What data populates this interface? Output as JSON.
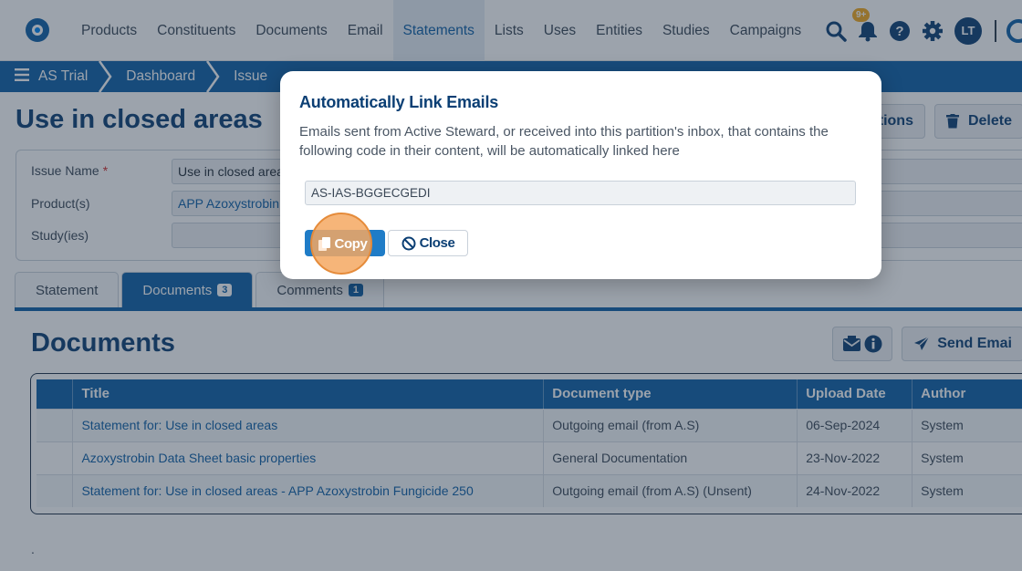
{
  "nav": {
    "items": [
      "Products",
      "Constituents",
      "Documents",
      "Email",
      "Statements",
      "Lists",
      "Uses",
      "Entities",
      "Studies",
      "Campaigns"
    ],
    "active_index": 4,
    "notification_badge": "9+",
    "avatar_initials": "LT",
    "icons": [
      "search-icon",
      "bell-icon",
      "help-icon",
      "gear-icon"
    ]
  },
  "breadcrumb": [
    "AS Trial",
    "Dashboard",
    "Issue"
  ],
  "page": {
    "title": "Use in closed areas",
    "actions": [
      "ations",
      "Delete"
    ]
  },
  "form": {
    "issue_name_label": "Issue Name",
    "issue_name_required": "*",
    "issue_name_value": "Use in closed area",
    "products_label": "Product(s)",
    "products_value": "APP Azoxystrobin",
    "studies_label": "Study(ies)",
    "studies_value": ""
  },
  "tabs": [
    {
      "label": "Statement",
      "count": ""
    },
    {
      "label": "Documents",
      "count": "3"
    },
    {
      "label": "Comments",
      "count": "1"
    }
  ],
  "documents": {
    "title": "Documents",
    "send_email_label": "Send Emai",
    "columns": [
      "",
      "Title",
      "Document type",
      "Upload Date",
      "Author"
    ],
    "rows": [
      {
        "title": "Statement for: Use in closed areas",
        "type": "Outgoing email (from A.S)",
        "date": "06-Sep-2024",
        "author": "System"
      },
      {
        "title": "Azoxystrobin Data Sheet basic properties",
        "type": "General Documentation",
        "date": "23-Nov-2022",
        "author": "System"
      },
      {
        "title": "Statement for: Use in closed areas - APP Azoxystrobin Fungicide 250",
        "type": "Outgoing email (from A.S)  (Unsent)",
        "date": "24-Nov-2022",
        "author": "System"
      }
    ]
  },
  "footer_text": ".",
  "modal": {
    "title": "Automatically Link Emails",
    "description": "Emails sent from Active Steward, or received into this partition's inbox, that contains the following code in their content, will be automatically linked here",
    "code": "AS-IAS-BGGECGEDI",
    "copy_label": "Copy",
    "close_label": "Close"
  },
  "colors": {
    "primary": "#0d5fa6",
    "dark": "#0b3f74",
    "highlight": "#f5a862"
  }
}
